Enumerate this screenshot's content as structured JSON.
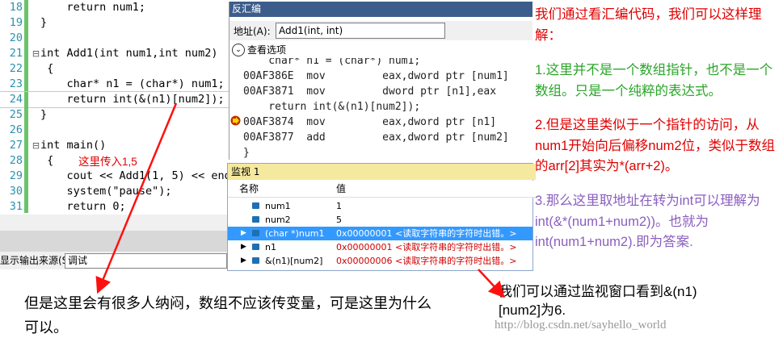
{
  "editor": {
    "lines": [
      {
        "num": "18",
        "code": "    return num1;"
      },
      {
        "num": "19",
        "code": "}"
      },
      {
        "num": "20",
        "code": ""
      },
      {
        "num": "21",
        "code": "int Add1(int num1,int num2)"
      },
      {
        "num": "22",
        "code": " {"
      },
      {
        "num": "23",
        "code": "    char* n1 = (char*) num1;"
      },
      {
        "num": "24",
        "code": "    return int(&(n1)[num2]);"
      },
      {
        "num": "25",
        "code": "}"
      },
      {
        "num": "26",
        "code": ""
      },
      {
        "num": "27",
        "code": "int main()"
      },
      {
        "num": "28",
        "code": " {"
      },
      {
        "num": "29",
        "code": "    cout << Add1(1, 5) << end"
      },
      {
        "num": "30",
        "code": "    system(\"pause\");"
      },
      {
        "num": "31",
        "code": "    return 0;"
      }
    ],
    "annotation": "这里传入1,5",
    "zoom": "%"
  },
  "disasm": {
    "title": "反汇编",
    "address_label": "地址(A):",
    "address_value": "Add1(int, int)",
    "options_label": "查看选项",
    "lines": [
      "    char* n1 = (char*) num1;",
      "00AF386E  mov         eax,dword ptr [num1]",
      "00AF3871  mov         dword ptr [n1],eax",
      "    return int(&(n1)[num2]);",
      "00AF3874  mov         eax,dword ptr [n1]",
      "00AF3877  add         eax,dword ptr [num2]",
      "}"
    ]
  },
  "watch": {
    "title": "监视 1",
    "col_name": "名称",
    "col_value": "值",
    "rows": [
      {
        "name": "num1",
        "value": "1",
        "expand": ""
      },
      {
        "name": "num2",
        "value": "5",
        "expand": ""
      },
      {
        "name": "(char *)num1",
        "value": "0x00000001 <读取字符串的字符时出错。>",
        "expand": "▶"
      },
      {
        "name": "n1",
        "value": "0x00000001 <读取字符串的字符时出错。>",
        "expand": "▶"
      },
      {
        "name": "&(n1)[num2]",
        "value": "0x00000006 <读取字符串的字符时出错。>",
        "expand": "▶"
      }
    ]
  },
  "output": {
    "label": "显示输出来源(S):",
    "source": "调试"
  },
  "notes": {
    "p1": "我们通过看汇编代码，我们可以这样理解：",
    "p2": "1.这里并不是一个数组指针，也不是一个数组。只是一个纯粹的表达式。",
    "p3": "2.但是这里类似于一个指针的访问，从num1开始向后偏移num2位，类似于数组的arr[2]其实为*(arr+2)。",
    "p4": "3.那么这里取地址在转为int可以理解为int(&*(num1+num2))。也就为int(num1+num2).即为答案.",
    "bottom": "但是这里会有很多人纳闷，数组不应该传变量，可是这里为什么可以。",
    "watch_note": "我们可以通过监视窗口看到&(n1)[num2]为6.",
    "watermark": "http://blog.csdn.net/sayhello_world"
  },
  "colors": {
    "accent_red": "#e00000",
    "green": "#2aa52a",
    "purple": "#8b5fbf",
    "selection": "#3399ff"
  }
}
